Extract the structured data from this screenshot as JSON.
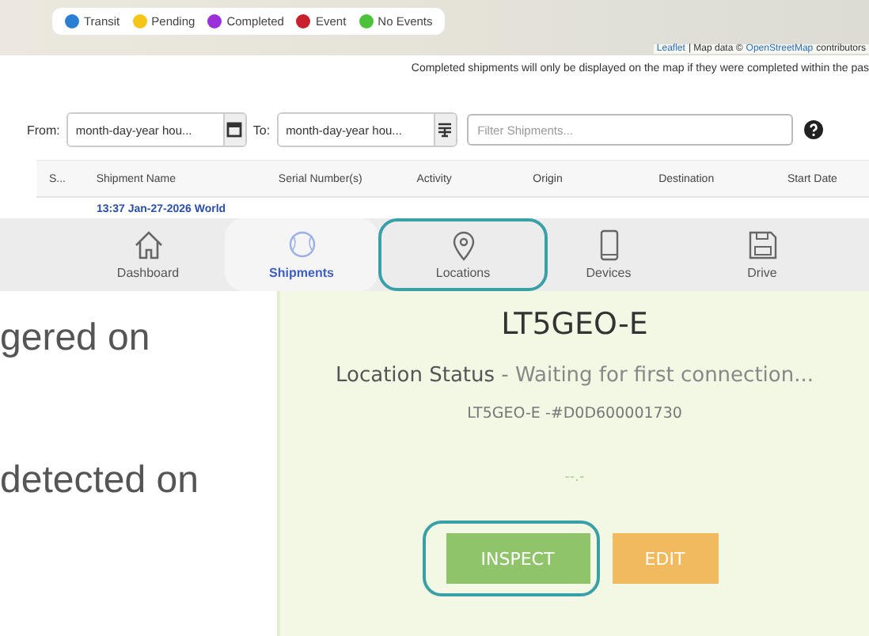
{
  "map": {
    "legend": [
      {
        "label": "Transit",
        "color": "#2a7fd4"
      },
      {
        "label": "Pending",
        "color": "#f5c518"
      },
      {
        "label": "Completed",
        "color": "#9b30d9"
      },
      {
        "label": "Event",
        "color": "#c8202f"
      },
      {
        "label": "No Events",
        "color": "#4cc13a"
      }
    ],
    "attribution": {
      "link": "Leaflet",
      "text": "| Map data ©",
      "osm": "OpenStreetMap",
      "tail": "contributors"
    }
  },
  "note": "Completed shipments will only be displayed on the map if they were completed within the pas",
  "filters": {
    "from_label": "From:",
    "from_placeholder": "month-day-year hou...",
    "to_label": "To:",
    "to_placeholder": "month-day-year hou...",
    "search_placeholder": "Filter Shipments..."
  },
  "table": {
    "columns": [
      "S...",
      "Shipment Name",
      "Serial Number(s)",
      "Activity",
      "Origin",
      "Destination",
      "Start Date"
    ],
    "rows": [
      {
        "shipment_name": "13:37 Jan-27-2026 World"
      }
    ]
  },
  "nav": [
    {
      "label": "Dashboard",
      "selected": false,
      "highlighted": false
    },
    {
      "label": "Shipments",
      "selected": true,
      "highlighted": false
    },
    {
      "label": "Locations",
      "selected": false,
      "highlighted": true
    },
    {
      "label": "Devices",
      "selected": false,
      "highlighted": false
    },
    {
      "label": "Drive",
      "selected": false,
      "highlighted": false
    }
  ],
  "side_text": [
    "gered on",
    "detected on"
  ],
  "card": {
    "title": "LT5GEO-E",
    "status_label": "Location Status",
    "status_value": "- Waiting for first connection...",
    "device_id": "LT5GEO-E -#D0D600001730",
    "reading": "--.-",
    "buttons": [
      {
        "label": "INSPECT",
        "kind": "inspect",
        "highlighted": true
      },
      {
        "label": "EDIT",
        "kind": "edit",
        "highlighted": false
      }
    ]
  }
}
